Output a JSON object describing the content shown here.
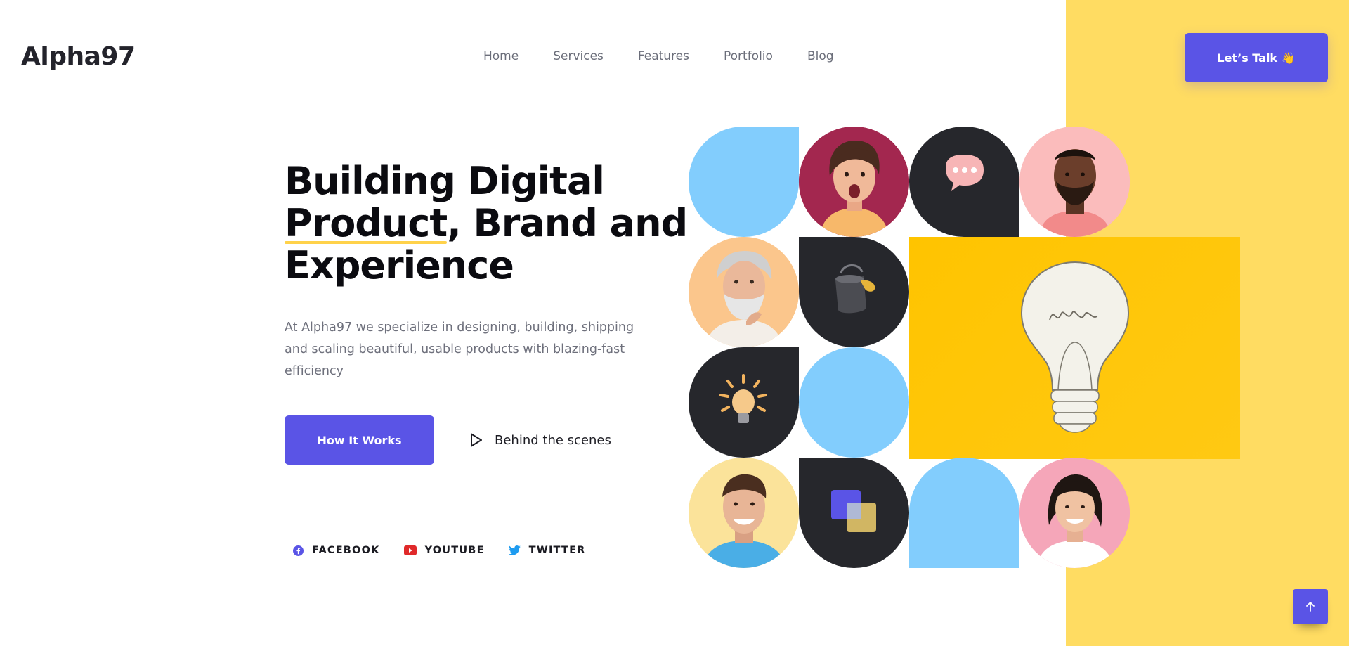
{
  "brand": {
    "logo": "Alpha97"
  },
  "nav": {
    "items": [
      "Home",
      "Services",
      "Features",
      "Portfolio",
      "Blog"
    ]
  },
  "header": {
    "cta_label": "Let’s Talk 👋"
  },
  "hero": {
    "title_line1": "Building Digital",
    "title_line2_underlined": "Product",
    "title_line2_rest": ", Brand and",
    "title_line3": "Experience",
    "description": "At Alpha97 we specialize in designing, building, shipping and scaling beautiful, usable products with blazing-fast efficiency",
    "primary_button": "How It Works",
    "secondary_link": "Behind the scenes"
  },
  "socials": [
    {
      "label": "FACEBOOK",
      "icon": "facebook-icon",
      "color": "#5a54e6"
    },
    {
      "label": "YOUTUBE",
      "icon": "youtube-icon",
      "color": "#e0292a"
    },
    {
      "label": "TWITTER",
      "icon": "twitter-icon",
      "color": "#1d9bf0"
    }
  ],
  "mosaic_icons": [
    "chat-bubble-icon",
    "paint-bucket-icon",
    "light-bulb-icon",
    "layered-squares-icon",
    "idea-bulb-illustration"
  ],
  "colors": {
    "accent": "#5a54e6",
    "yellow_panel": "#ffdc62",
    "tile_blue": "#82cdfd",
    "tile_dark": "#26272c",
    "idea_yellow": "#ffc400"
  }
}
